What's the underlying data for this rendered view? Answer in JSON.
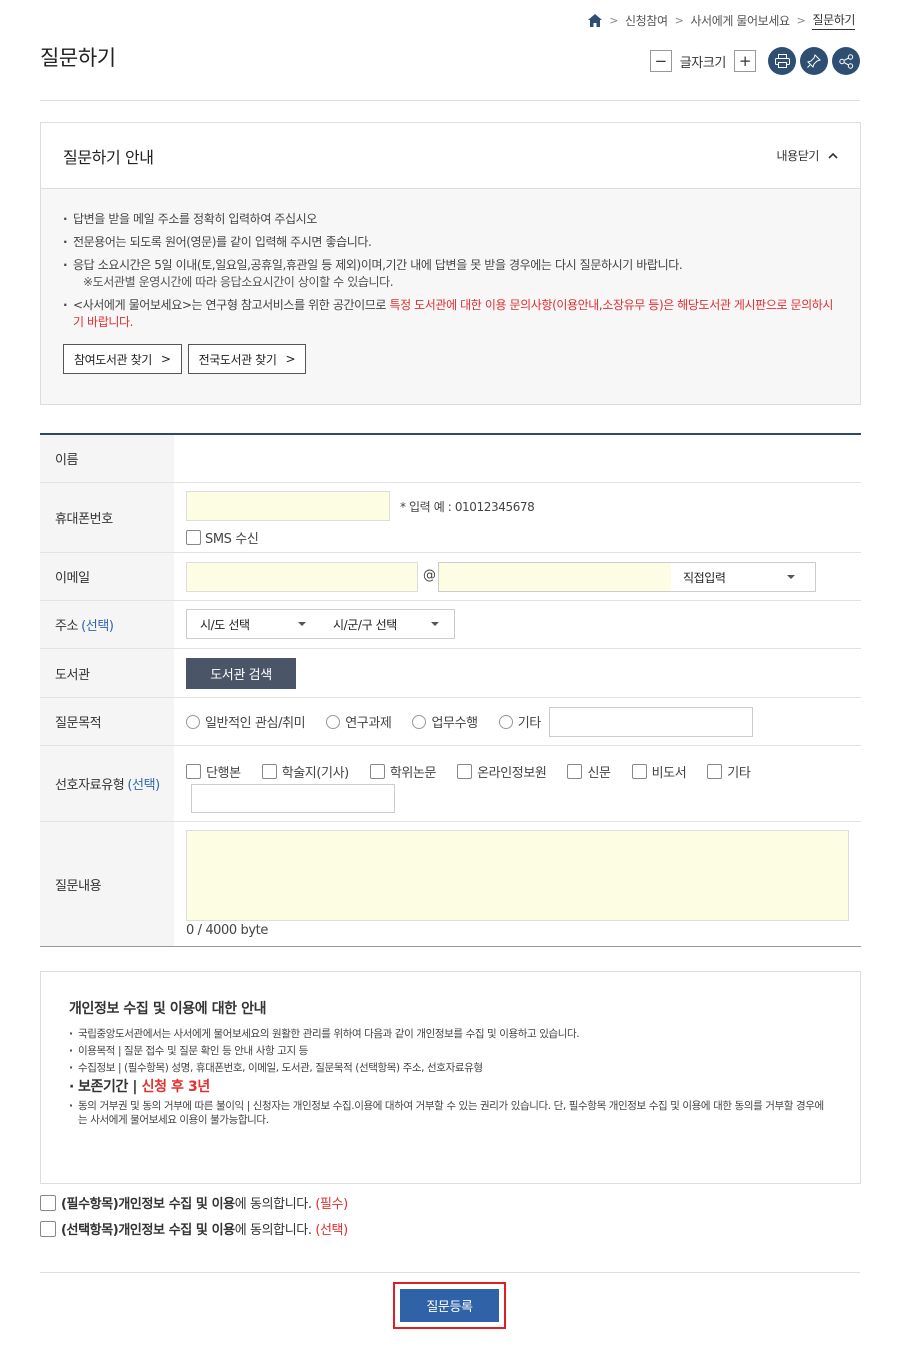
{
  "breadcrumb": {
    "items": [
      "신청참여",
      "사서에게 물어보세요",
      "질문하기"
    ]
  },
  "page_title": "질문하기",
  "toolbar": {
    "minus": "−",
    "plus": "+",
    "font_size_label": "글자크기"
  },
  "guide": {
    "title": "질문하기 안내",
    "close_label": "내용닫기",
    "lines": [
      "답변을 받을 메일 주소를 정확히 입력하여 주십시오",
      "전문용어는 되도록 원어(영문)를 같이 입력해 주시면 좋습니다.",
      "응답 소요시간은 5일 이내(토,일요일,공휴일,휴관일 등 제외)이며,기간 내에 답변을 못 받을 경우에는 다시 질문하시기 바랍니다."
    ],
    "sub_note": "※도서관별 운영시간에 따라 응답소요시간이 상이할 수 있습니다.",
    "line4_prefix": "<사서에게 물어보세요>는 연구형 참고서비스를 위한 공간이므로 ",
    "line4_red": "특정 도서관에 대한 이용 문의사항(이용안내,소장유무 등)은 해당도서관 게시판으로 문의하시기 바랍니다.",
    "btn_participating": "참여도서관 찾기",
    "btn_national": "전국도서관 찾기"
  },
  "form": {
    "name_label": "이름",
    "phone_label": "휴대폰번호",
    "phone_example": "* 입력 예 : 01012345678",
    "sms_label": "SMS 수신",
    "email_label": "이메일",
    "email_at": "@",
    "email_domain_select": "직접입력",
    "address_label": "주소",
    "optional": "(선택)",
    "sido_select": "시/도 선택",
    "sigungu_select": "시/군/구 선택",
    "library_label": "도서관",
    "library_search_btn": "도서관 검색",
    "purpose_label": "질문목적",
    "purpose_options": [
      "일반적인 관심/취미",
      "연구과제",
      "업무수행",
      "기타"
    ],
    "material_label": "선호자료유형",
    "material_options": [
      "단행본",
      "학술지(기사)",
      "학위논문",
      "온라인정보원",
      "신문",
      "비도서",
      "기타"
    ],
    "content_label": "질문내용",
    "byte_counter": "0 / 4000 byte"
  },
  "privacy": {
    "title": "개인정보 수집 및 이용에 대한 안내",
    "lines": [
      "국립중앙도서관에서는 사서에게 물어보세요의 원활한 관리를 위하여 다음과 같이 개인정보를 수집 및 이용하고 있습니다.",
      "이용목적 | 질문 접수 및 질문 확인 등 안내 사항 고지 등",
      "수집정보 | (필수항목) 성명, 휴대폰번호, 이메일, 도서관, 질문목적 (선택항목) 주소, 선호자료유형"
    ],
    "retention_label": "보존기간 | ",
    "retention_value": "신청 후 3년",
    "refusal": "동의 거부권 및 동의 거부에 따른 불이익 | 신청자는 개인정보 수집.이용에 대하여 거부할 수 있는 권리가 있습니다. 단, 필수항목 개인정보 수집 및 이용에 대한 동의를 거부할 경우에는 사서에게 물어보세요 이용이 불가능합니다."
  },
  "agree": {
    "required_bold": "(필수항목)개인정보 수집 및 이용",
    "required_rest": "에 동의합니다. ",
    "required_tag": "(필수)",
    "optional_bold": "(선택항목)개인정보 수집 및 이용",
    "optional_rest": "에 동의합니다. ",
    "optional_tag": "(선택)"
  },
  "submit_label": "질문등록",
  "colors": {
    "accent": "#3062a8",
    "navy": "#2f4f72",
    "red": "#e03030",
    "input_bg": "#fdfde3"
  }
}
